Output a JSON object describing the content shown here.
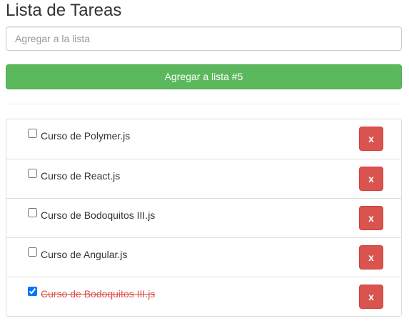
{
  "header": {
    "title": "Lista de Tareas"
  },
  "form": {
    "placeholder": "Agregar a la lista",
    "value": "",
    "add_label": "Agregar a lista #5"
  },
  "tasks": [
    {
      "label": "Curso de Polymer.js",
      "done": false,
      "delete_label": "x"
    },
    {
      "label": "Curso de React.js",
      "done": false,
      "delete_label": "x"
    },
    {
      "label": "Curso de Bodoquitos III.js",
      "done": false,
      "delete_label": "x"
    },
    {
      "label": "Curso de Angular.js",
      "done": false,
      "delete_label": "x"
    },
    {
      "label": "Curso de Bodoquitos III.js",
      "done": true,
      "delete_label": "x"
    }
  ],
  "colors": {
    "success": "#5cb85c",
    "danger": "#d9534f",
    "border": "#dddddd"
  }
}
